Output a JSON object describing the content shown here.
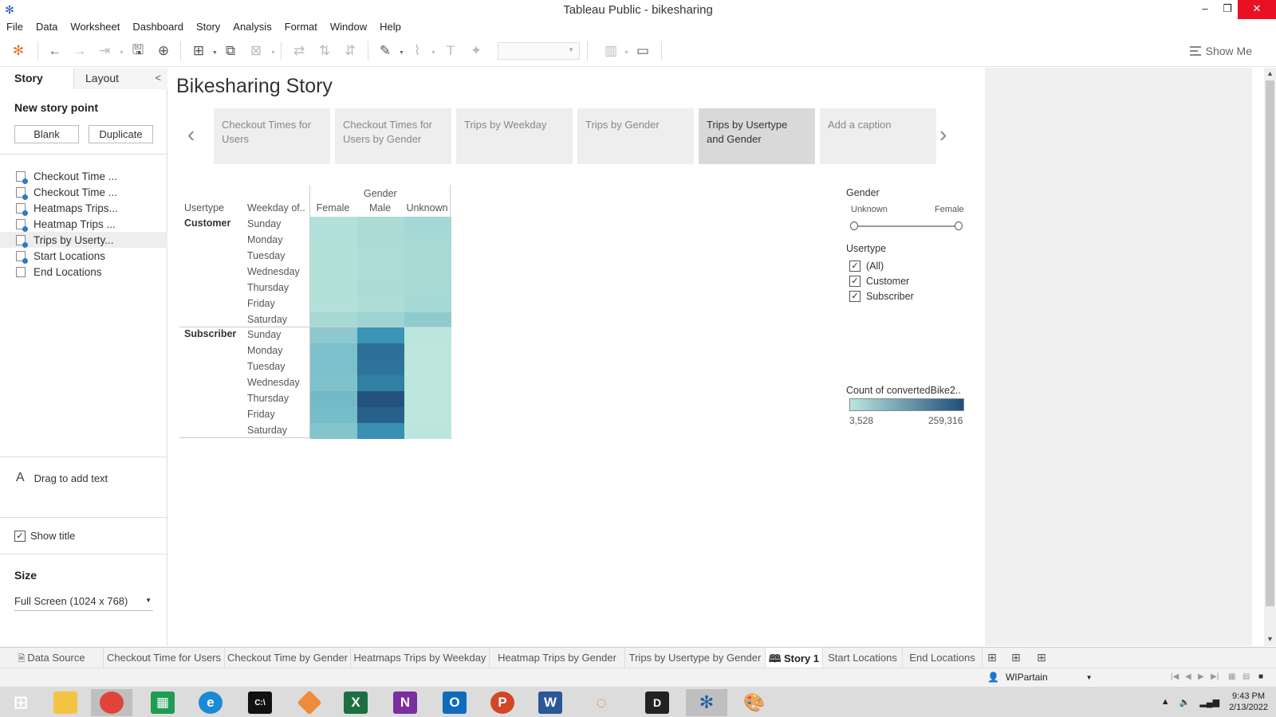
{
  "window": {
    "title": "Tableau Public - bikesharing",
    "minimize": "–",
    "maximize": "❐",
    "close": "✕"
  },
  "menu": [
    "File",
    "Data",
    "Worksheet",
    "Dashboard",
    "Story",
    "Analysis",
    "Format",
    "Window",
    "Help"
  ],
  "toolbar": {
    "show_me": "Show Me"
  },
  "left_panel": {
    "tabs": {
      "story": "Story",
      "layout": "Layout"
    },
    "new_story_point": "New story point",
    "blank_button": "Blank",
    "duplicate_button": "Duplicate",
    "sheets": [
      {
        "label": "Checkout Time ...",
        "badge": true
      },
      {
        "label": "Checkout Time ...",
        "badge": true
      },
      {
        "label": "Heatmaps Trips...",
        "badge": true
      },
      {
        "label": "Heatmap Trips ...",
        "badge": true
      },
      {
        "label": "Trips by Userty...",
        "badge": true
      },
      {
        "label": "Start Locations",
        "badge": true
      },
      {
        "label": "End Locations",
        "badge": false
      }
    ],
    "drag_text": "Drag to add text",
    "show_title": "Show title",
    "size_label": "Size",
    "size_value": "Full Screen (1024 x 768)"
  },
  "story": {
    "title": "Bikesharing Story",
    "nav_points": [
      {
        "caption": "Checkout Times for Users",
        "active": false
      },
      {
        "caption": "Checkout Times for Users by Gender",
        "active": false
      },
      {
        "caption": "Trips by Weekday",
        "active": false
      },
      {
        "caption": "Trips by Gender",
        "active": false
      },
      {
        "caption": "Trips by Usertype and Gender",
        "active": true
      },
      {
        "caption": "Add a caption",
        "active": false
      }
    ]
  },
  "heatmap": {
    "col_group_header": "Gender",
    "row_header_1": "Usertype",
    "row_header_2": "Weekday of..",
    "columns": [
      "Female",
      "Male",
      "Unknown"
    ],
    "groups": [
      {
        "name": "Customer",
        "days": [
          "Sunday",
          "Monday",
          "Tuesday",
          "Wednesday",
          "Thursday",
          "Friday",
          "Saturday"
        ],
        "colors": [
          [
            "#b2e0da",
            "#addcd7",
            "#a3d8d5"
          ],
          [
            "#b3e1da",
            "#addcd7",
            "#a7dad5"
          ],
          [
            "#b3e1da",
            "#aedcd7",
            "#a8dad6"
          ],
          [
            "#b3e1da",
            "#aedcd7",
            "#a8dad6"
          ],
          [
            "#b3e1da",
            "#addcd7",
            "#a7dad5"
          ],
          [
            "#b3e1da",
            "#aedcd7",
            "#a5d9d5"
          ],
          [
            "#a7d9d4",
            "#9fd4d3",
            "#8ecbcf"
          ]
        ]
      },
      {
        "name": "Subscriber",
        "days": [
          "Sunday",
          "Monday",
          "Tuesday",
          "Wednesday",
          "Thursday",
          "Friday",
          "Saturday"
        ],
        "colors": [
          [
            "#8ec9cf",
            "#3a95b7",
            "#bce6dd"
          ],
          [
            "#7cc0cb",
            "#2d6f98",
            "#bde6dd"
          ],
          [
            "#7cc0cb",
            "#2e7399",
            "#bde6dd"
          ],
          [
            "#80c2cc",
            "#327fa4",
            "#bde6dd"
          ],
          [
            "#72bac8",
            "#24527f",
            "#bde6dd"
          ],
          [
            "#76bcc9",
            "#27608a",
            "#bde6dd"
          ],
          [
            "#84c4cd",
            "#3a8fb5",
            "#bce6dd"
          ]
        ]
      }
    ]
  },
  "legend": {
    "gender_title": "Gender",
    "gender_min": "Unknown",
    "gender_max": "Female",
    "usertype_title": "Usertype",
    "usertype_options": [
      "(All)",
      "Customer",
      "Subscriber"
    ],
    "count_title": "Count of convertedBike2..",
    "count_min": "3,528",
    "count_max": "259,316",
    "ramp_colors": [
      "#b9e6de",
      "#1f4e7a"
    ]
  },
  "sheet_tabs": [
    {
      "label": "Data Source",
      "active": false
    },
    {
      "label": "Checkout Time for Users",
      "active": false
    },
    {
      "label": "Checkout Time by Gender",
      "active": false
    },
    {
      "label": "Heatmaps Trips by Weekday",
      "active": false
    },
    {
      "label": "Heatmap Trips by Gender",
      "active": false
    },
    {
      "label": "Trips by Usertype by Gender",
      "active": false
    },
    {
      "label": "Story 1",
      "active": true
    },
    {
      "label": "Start Locations",
      "active": false
    },
    {
      "label": "End Locations",
      "active": false
    }
  ],
  "status": {
    "user": "WIPartain"
  },
  "taskbar": {
    "time": "9:43 PM",
    "date": "2/13/2022"
  }
}
